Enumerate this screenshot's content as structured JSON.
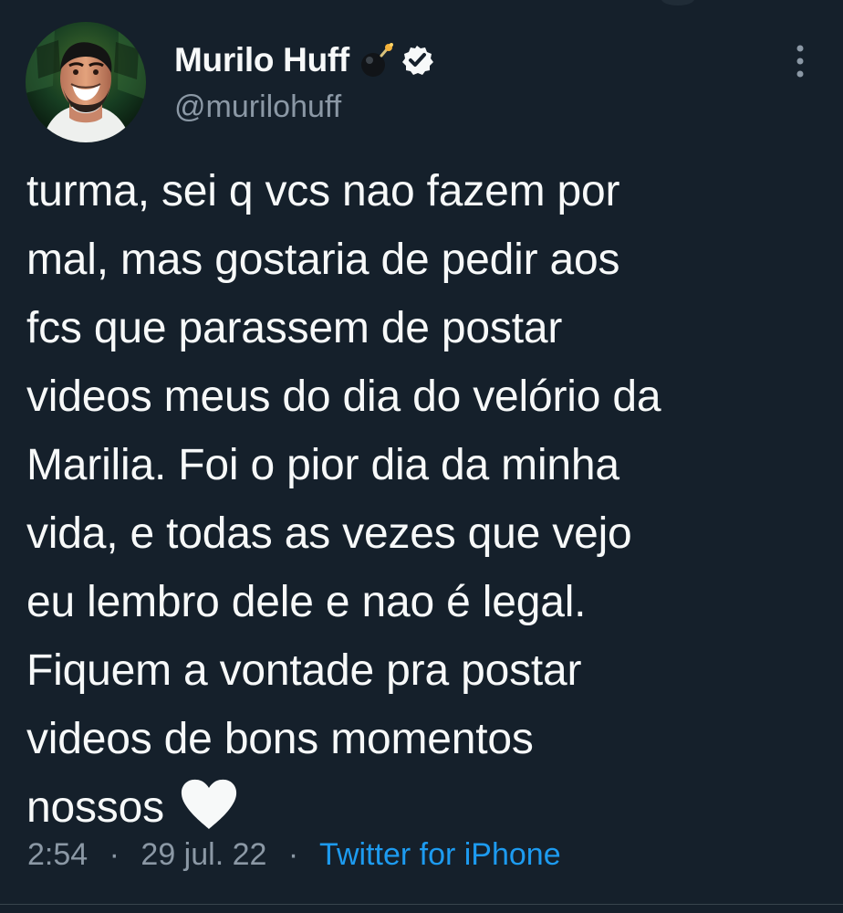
{
  "user": {
    "display_name": "Murilo Huff",
    "handle": "@murilohuff",
    "avatar_icon": "profile-avatar-photo",
    "emoji_icon": "bomb-icon",
    "verified_icon": "verified-badge-icon",
    "colors": {
      "verified": "#f7f9f9",
      "handle": "#8b98a5"
    }
  },
  "tweet": {
    "lines": [
      "turma, sei q vcs nao fazem por",
      "mal, mas gostaria de pedir aos",
      "fcs que parassem de postar",
      "videos meus do dia do velório da",
      "Marilia. Foi o pior dia da minha",
      "vida, e todas as vezes que vejo",
      "eu lembro dele e nao é legal.",
      "Fiquem a vontade pra postar",
      "videos de bons momentos",
      "nossos"
    ],
    "emoji": "white-heart-icon"
  },
  "meta": {
    "time": "2:54",
    "date": "29 jul. 22",
    "separator": "·",
    "source": "Twitter for iPhone"
  },
  "actions": {
    "more_icon": "more-vertical-icon"
  },
  "colors": {
    "background": "#15202b",
    "text": "#f7f9f9",
    "muted": "#8b98a5",
    "link": "#1d9bf0",
    "divider": "#38444d"
  }
}
